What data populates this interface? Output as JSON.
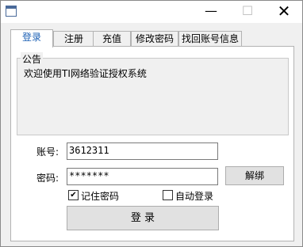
{
  "window": {
    "title": "",
    "minimize_glyph": "—",
    "maximize_glyph": "☐",
    "close_glyph": "✕"
  },
  "tabs": [
    {
      "label": "登录",
      "active": true
    },
    {
      "label": "注册",
      "active": false
    },
    {
      "label": "充值",
      "active": false
    },
    {
      "label": "修改密码",
      "active": false
    },
    {
      "label": "找回账号信息",
      "active": false
    }
  ],
  "notice": {
    "legend": "公告",
    "text": "欢迎使用TI网络验证授权系统"
  },
  "form": {
    "account_label": "账号:",
    "account_value": "3612311",
    "password_label": "密码:",
    "password_value": "*******",
    "unbind_button": "解绑",
    "remember_label": "记住密码",
    "remember_checked": true,
    "autologin_label": "自动登录",
    "autologin_checked": false,
    "login_button": "登 录",
    "check_glyph": "✔"
  }
}
